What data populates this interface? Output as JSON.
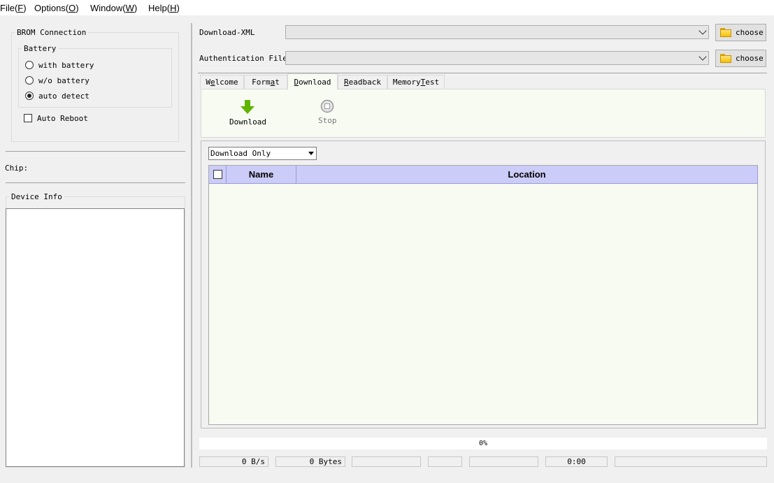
{
  "menu": [
    {
      "label": "File(",
      "key": "F",
      "suffix": ")"
    },
    {
      "label": "Options(",
      "key": "O",
      "suffix": ")"
    },
    {
      "label": "Window(",
      "key": "W",
      "suffix": ")"
    },
    {
      "label": "Help(",
      "key": "H",
      "suffix": ")"
    }
  ],
  "left": {
    "brom_title": "BROM Connection",
    "battery_title": "Battery",
    "options": [
      {
        "label": "with battery",
        "checked": false
      },
      {
        "label": "w/o battery",
        "checked": false
      },
      {
        "label": "auto detect",
        "checked": true
      }
    ],
    "auto_reboot": "Auto Reboot",
    "chip_label": "Chip:",
    "device_info_title": "Device Info"
  },
  "files": {
    "download_xml_label": "Download-XML",
    "download_xml_value": "",
    "auth_file_label": "Authentication File",
    "auth_file_value": "",
    "choose_label": "choose"
  },
  "tabs": [
    {
      "pre": "W",
      "key": "e",
      "post": "lcome",
      "active": false
    },
    {
      "pre": "Form",
      "key": "a",
      "post": "t",
      "active": false
    },
    {
      "pre": "",
      "key": "D",
      "post": "ownload",
      "active": true
    },
    {
      "pre": "",
      "key": "R",
      "post": "eadback",
      "active": false
    },
    {
      "pre": "Memory",
      "key": "T",
      "post": "est",
      "active": false
    }
  ],
  "toolbar": {
    "download_label": "Download",
    "stop_label": "Stop",
    "download_icon_color": "#5fb400",
    "stop_icon_color": "#9a9a9a"
  },
  "download": {
    "mode": "Download Only",
    "columns": [
      "Name",
      "Location"
    ],
    "rows": []
  },
  "status": {
    "progress_text": "0%",
    "progress_fraction": 0,
    "speed": "0 B/s",
    "bytes": "0 Bytes",
    "cell3": "",
    "cell4": "",
    "cell5": "",
    "time": "0:00",
    "cell7": ""
  }
}
